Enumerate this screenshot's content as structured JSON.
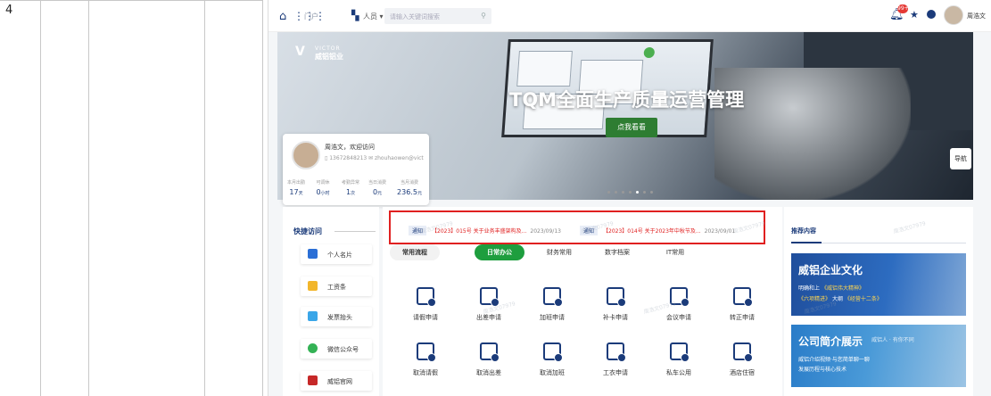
{
  "sheet": {
    "row_number": "4"
  },
  "topbar": {
    "portal_label": "门户",
    "scope_label": "人员 ▾",
    "search_placeholder": "请输入关键词搜索",
    "badge_count": "99+",
    "username": "周浩文"
  },
  "hero": {
    "logo_en": "VICTOR",
    "logo_cn": "威铝铝业",
    "title": "TQM全面生产质量运营管理",
    "button_label": "点我看看",
    "nav_label": "导航"
  },
  "usercard": {
    "greeting": "周浩文，欢迎访问",
    "phone": "13672848213",
    "email": "zhouhaowen@vict",
    "stats": [
      {
        "label": "本月出勤",
        "value": "17",
        "unit": "天"
      },
      {
        "label": "可调休",
        "value": "0",
        "unit": "小时"
      },
      {
        "label": "考勤异常",
        "value": "1",
        "unit": "次"
      },
      {
        "label": "当日消费",
        "value": "0",
        "unit": "元"
      },
      {
        "label": "当月消费",
        "value": "236.5",
        "unit": "元"
      }
    ]
  },
  "quick": {
    "title": "快捷访问",
    "items": [
      {
        "label": "个人名片",
        "color": "#2b6fd6"
      },
      {
        "label": "工资条",
        "color": "#f2b62b"
      },
      {
        "label": "发票抬头",
        "color": "#3aa6e8"
      },
      {
        "label": "微信公众号",
        "color": "#34b255"
      },
      {
        "label": "威铝官网",
        "color": "#c62828"
      }
    ]
  },
  "notices": [
    {
      "tag": "通知",
      "text": "【2023】015号 关于业务丰盛架构及...",
      "date": "2023/09/13"
    },
    {
      "tag": "通知",
      "text": "【2023】014号 关于2023年中秋节及...",
      "date": "2023/09/01"
    }
  ],
  "tabs": [
    {
      "label": "常用流程"
    },
    {
      "label": "日常办公"
    },
    {
      "label": "财务常用"
    },
    {
      "label": "数字档案"
    },
    {
      "label": "IT常用"
    }
  ],
  "apps": [
    {
      "label": "请假申请"
    },
    {
      "label": "出差申请"
    },
    {
      "label": "加班申请"
    },
    {
      "label": "补卡申请"
    },
    {
      "label": "会议申请"
    },
    {
      "label": "转正申请"
    },
    {
      "label": "取消请假"
    },
    {
      "label": "取消出差"
    },
    {
      "label": "取消加班"
    },
    {
      "label": "工衣申请"
    },
    {
      "label": "私车公用"
    },
    {
      "label": "酒店住宿"
    }
  ],
  "recommend": {
    "title": "推荐内容",
    "cards": [
      {
        "title": "威铝企业文化",
        "line1_a": "明确和上",
        "line1_b": "《威铝伟大精神》",
        "line2_a": "《六项精进》",
        "line2_b": "大纲",
        "line2_c": "《经营十二条》"
      },
      {
        "title": "公司简介展示",
        "sub": "威铝人 · 有你不同",
        "line1": "威铝介绍视频·与您简单聊一聊",
        "line2": "发展历程与核心技术"
      }
    ]
  },
  "watermark": "周浩文07979"
}
